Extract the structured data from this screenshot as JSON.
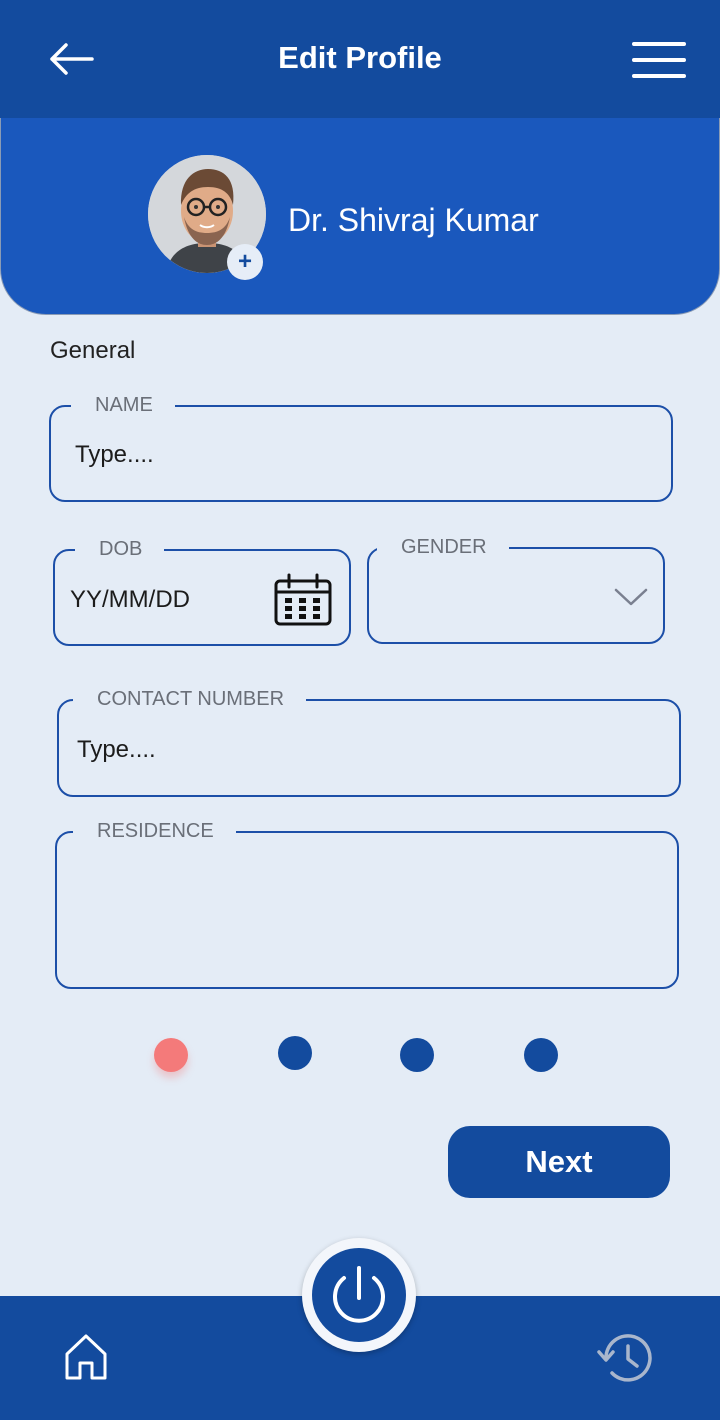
{
  "header": {
    "title": "Edit Profile",
    "back_icon": "arrow-left-icon",
    "menu_icon": "hamburger-menu-icon"
  },
  "profile": {
    "name": "Dr. Shivraj Kumar",
    "add_photo_symbol": "+"
  },
  "form": {
    "section_title": "General",
    "name": {
      "label": "NAME",
      "placeholder": "Type...."
    },
    "dob": {
      "label": "DOB",
      "placeholder": "YY/MM/DD",
      "icon": "calendar-icon"
    },
    "gender": {
      "label": "GENDER",
      "value": "",
      "icon": "chevron-down-icon"
    },
    "contact": {
      "label": "CONTACT NUMBER",
      "placeholder": "Type...."
    },
    "residence": {
      "label": "RESIDENCE",
      "placeholder": ""
    }
  },
  "pagination": {
    "active_index": 0,
    "total": 4,
    "active_color": "#f47a7a",
    "inactive_color": "#134b9e"
  },
  "actions": {
    "next_label": "Next"
  },
  "bottom_nav": {
    "home_icon": "home-icon",
    "power_icon": "power-icon",
    "history_icon": "history-icon"
  },
  "colors": {
    "primary": "#134b9e",
    "header_blue": "#1a58bd",
    "background": "#e4ecf6",
    "accent": "#f47a7a"
  }
}
